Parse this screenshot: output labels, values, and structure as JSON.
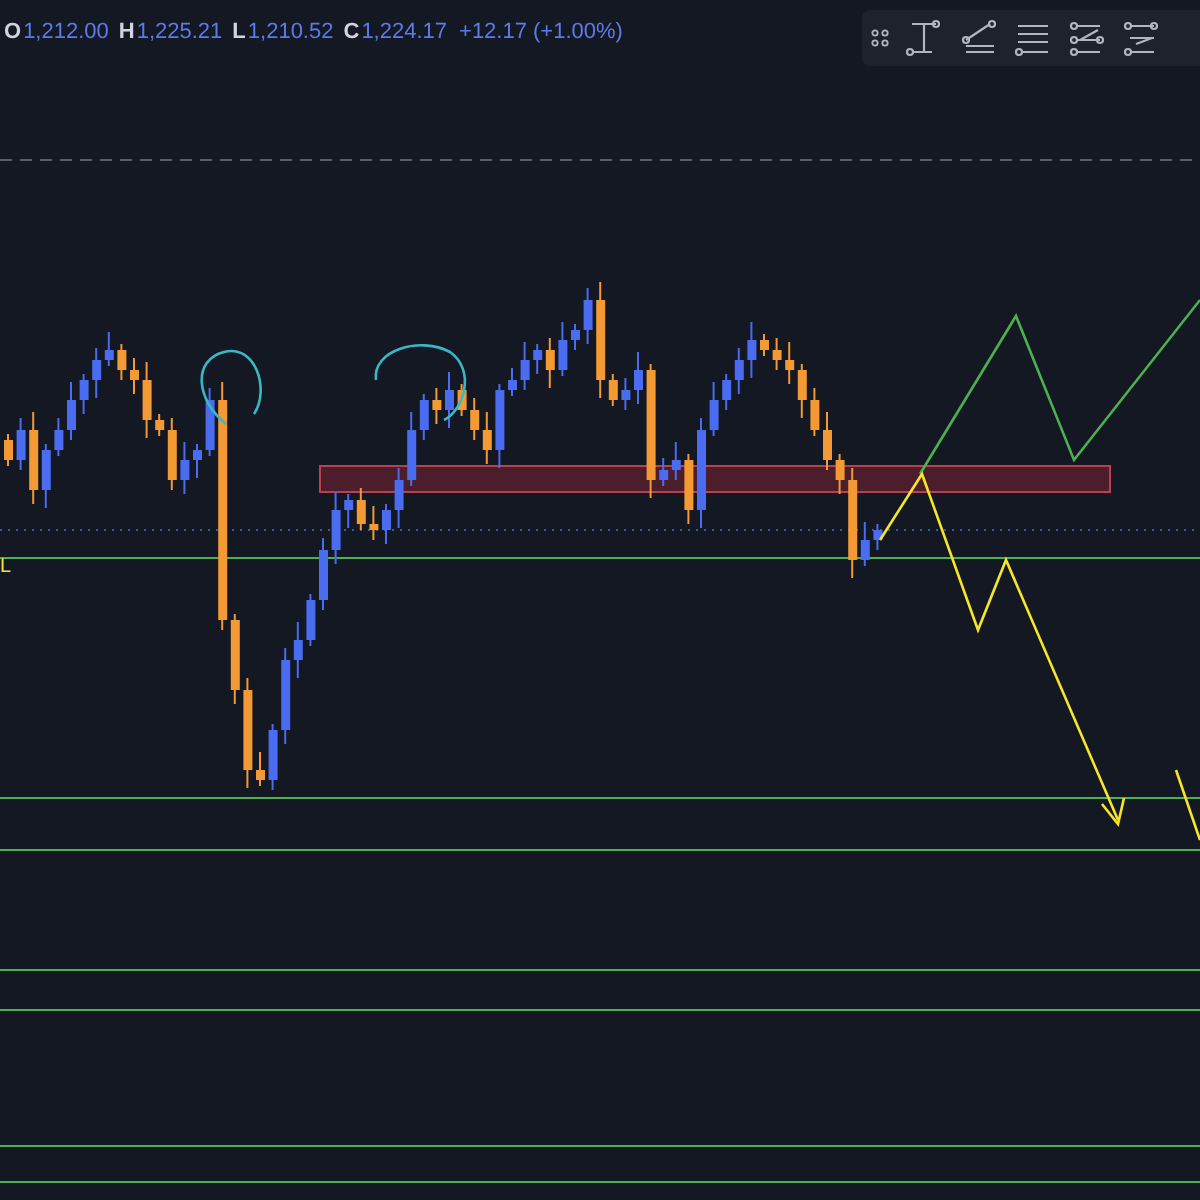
{
  "legend": {
    "items": [
      {
        "label": "O",
        "value": "1,212.00"
      },
      {
        "label": "H",
        "value": "1,225.21"
      },
      {
        "label": "L",
        "value": "1,210.52"
      },
      {
        "label": "C",
        "value": "1,224.17"
      }
    ],
    "change": "+12.17 (+1.00%)"
  },
  "price_labels": [
    {
      "text": "L"
    }
  ]
}
